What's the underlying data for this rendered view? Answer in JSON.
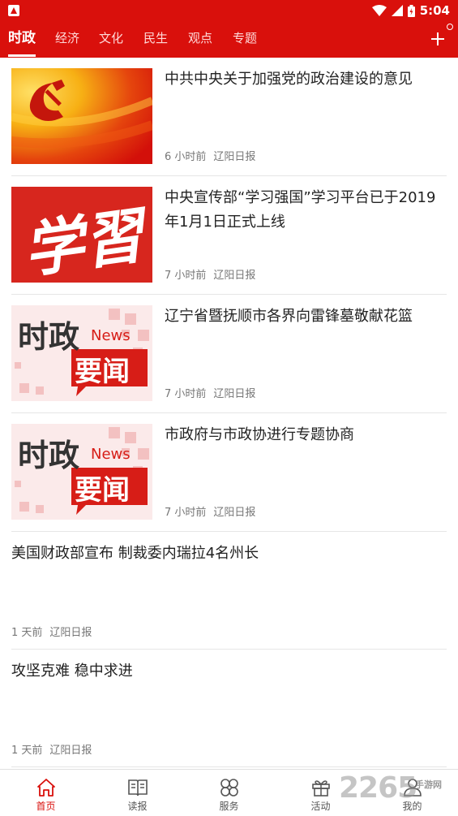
{
  "status_bar": {
    "time": "5:04"
  },
  "tabs": [
    {
      "label": "时政",
      "active": true
    },
    {
      "label": "经济"
    },
    {
      "label": "文化"
    },
    {
      "label": "民生"
    },
    {
      "label": "观点"
    },
    {
      "label": "专题"
    }
  ],
  "feed": {
    "items": [
      {
        "title": "中共中央关于加强党的政治建设的意见",
        "time": "6 小时前",
        "source": "辽阳日报",
        "thumb": "party-emblem-image"
      },
      {
        "title": "中央宣传部“学习强国”学习平台已于2019年1月1日正式上线",
        "time": "7 小时前",
        "source": "辽阳日报",
        "thumb": "xuexi-calligraphy-image"
      },
      {
        "title": "辽宁省暨抚顺市各界向雷锋墓敬献花篮",
        "time": "7 小时前",
        "source": "辽阳日报",
        "thumb": "politics-news-image"
      },
      {
        "title": "市政府与市政协进行专题协商",
        "time": "7 小时前",
        "source": "辽阳日报",
        "thumb": "politics-news-image"
      },
      {
        "title": "美国财政部宣布 制裁委内瑞拉4名州长",
        "time": "1 天前",
        "source": "辽阳日报"
      },
      {
        "title": "攻坚克难 稳中求进",
        "time": "1 天前",
        "source": "辽阳日报"
      }
    ],
    "thumb_text": {
      "xuexi": "学習",
      "shizheng": "时政",
      "news": "News",
      "yaowen": "要闻"
    }
  },
  "bottom_nav": [
    {
      "label": "首页",
      "icon": "home-icon",
      "active": true
    },
    {
      "label": "读报",
      "icon": "book-icon"
    },
    {
      "label": "服务",
      "icon": "grid-icon"
    },
    {
      "label": "活动",
      "icon": "gift-icon"
    },
    {
      "label": "我的",
      "icon": "user-icon"
    }
  ],
  "watermark": {
    "text": "2265",
    "sub": "手游网"
  },
  "colors": {
    "brand_red": "#d9100c",
    "text": "#222222",
    "meta": "#777777"
  }
}
